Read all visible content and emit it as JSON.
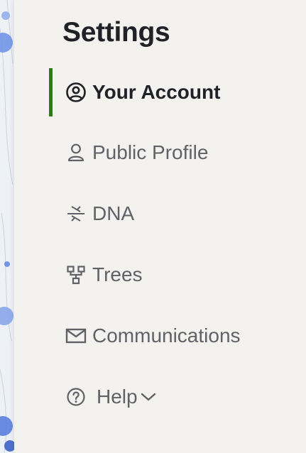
{
  "settings_menu": {
    "title": "Settings",
    "items": [
      {
        "label": "Your Account",
        "icon": "account-circle-icon",
        "active": true
      },
      {
        "label": "Public Profile",
        "icon": "person-icon",
        "active": false
      },
      {
        "label": "DNA",
        "icon": "dna-icon",
        "active": false
      },
      {
        "label": "Trees",
        "icon": "tree-icon",
        "active": false
      },
      {
        "label": "Communications",
        "icon": "mail-icon",
        "active": false
      },
      {
        "label": "Help",
        "icon": "help-circle-icon",
        "active": false,
        "has_dropdown": true
      }
    ]
  },
  "colors": {
    "active_indicator": "#2b7a12",
    "panel_background": "#f4f2ef",
    "active_text": "#1f2226",
    "inactive_text": "#5f6267"
  }
}
